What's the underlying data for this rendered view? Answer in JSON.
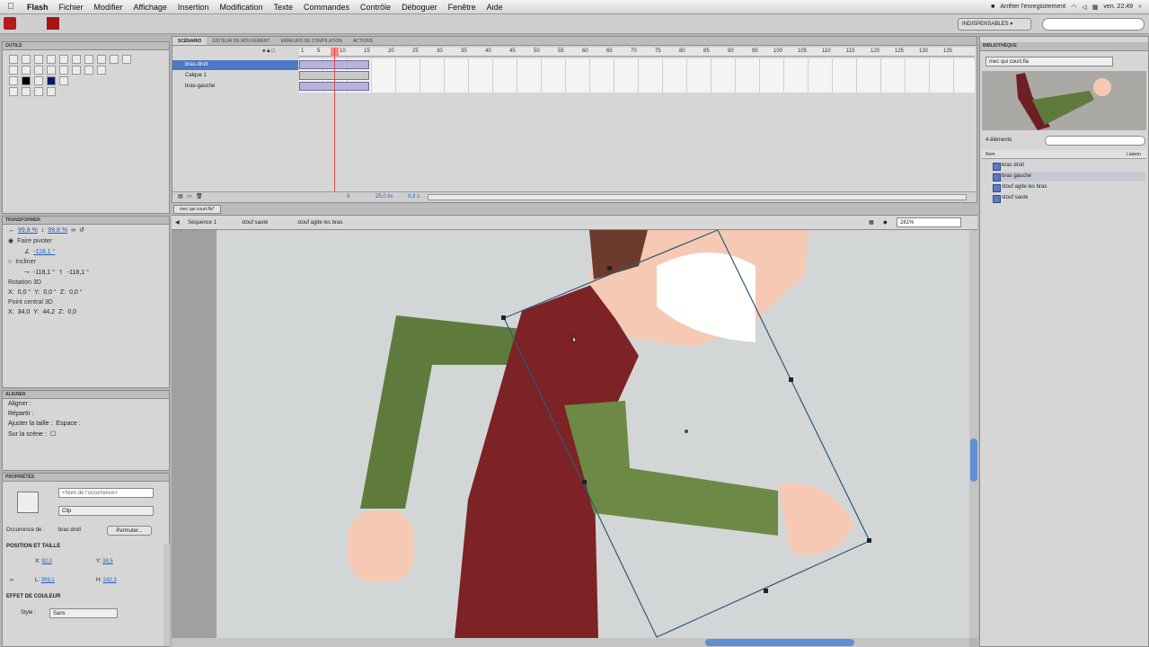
{
  "menubar": {
    "apple": "",
    "items": [
      "Flash",
      "Fichier",
      "Modifier",
      "Affichage",
      "Insertion",
      "Modification",
      "Texte",
      "Commandes",
      "Contrôle",
      "Déboguer",
      "Fenêtre",
      "Aide"
    ],
    "status_right": "Arrêter l'enregistrement",
    "clock": "ven. 22:49"
  },
  "appbar": {
    "workspace": "INDISPENSABLES ▾",
    "search_placeholder": ""
  },
  "tools_panel": {
    "title": "OUTILS"
  },
  "timeline": {
    "tabs": [
      "SCÉNARIO",
      "ÉDITEUR DE MOUVEMENT",
      "ERREURS DE COMPILATION",
      "ACTIONS"
    ],
    "layers": [
      "bras-droit",
      "Calque 1",
      "bras-gauche"
    ],
    "frame_numbers": [
      "1",
      "5",
      "10",
      "15",
      "20",
      "25",
      "30",
      "35",
      "40",
      "45",
      "50",
      "55",
      "60",
      "65",
      "70",
      "75",
      "80",
      "85",
      "90",
      "95",
      "100",
      "105",
      "110",
      "115",
      "120",
      "125",
      "130",
      "135"
    ],
    "status_frame": "9",
    "status_fps": "25,0 i/s",
    "status_time": "0,3 s"
  },
  "document": {
    "tab": "mec qui court.fla*",
    "breadcrumbs": [
      "Séquence 1",
      "stouf saute",
      "stouf agite les bras"
    ],
    "zoom": "281%"
  },
  "transform_panel": {
    "title": "TRANSFORMER",
    "width_pct": "99,8 %",
    "height_pct": "99,8 %",
    "rotate_label": "Faire pivoter",
    "rotate_value": "-118,1 °",
    "skew_label": "Incliner",
    "skew_h": "-118,1 °",
    "skew_v": "-118,1 °",
    "rot3d_label": "Rotation 3D",
    "rot3d": [
      "0,0 °",
      "0,0 °",
      "0,0 °"
    ],
    "center3d_label": "Point central 3D",
    "center3d": [
      "34,0",
      "44,2",
      "0,0"
    ]
  },
  "align_panel": {
    "title": "ALIGNER",
    "align_label": "Aligner :",
    "distribute_label": "Répartir :",
    "match_label": "Ajuster la taille :",
    "space_label": "Espace :",
    "to_stage": "Sur la scène :"
  },
  "properties_panel": {
    "title": "PROPRIÉTÉS",
    "instance_placeholder": "<Nom de l'occurrence>",
    "symbol_type": "Clip",
    "instance_of_label": "Occurrence de :",
    "instance_of_value": "bras droit",
    "swap_button": "Permuter...",
    "section_position": "POSITION ET TAILLE",
    "x": "92,0",
    "y": "38,5",
    "w": "309,1",
    "h": "242,3",
    "section_color": "EFFET DE COULEUR",
    "style_label": "Style :",
    "style_value": "Sans"
  },
  "library": {
    "title": "BIBLIOTHÈQUE",
    "doc_select": "mec qui court.fla",
    "count": "4 éléments",
    "column_name": "Nom",
    "column_link": "Liaison",
    "items": [
      "bras droit",
      "bras gauche",
      "stouf agite les bras",
      "stouf saute"
    ]
  },
  "colors": {
    "shirt": "#7d2225",
    "sleeve": "#5f7b3c",
    "skin": "#f5c9b4",
    "hair": "#6d3b2e",
    "selection": "#4d78c4",
    "bbox": "#2c5a7a"
  }
}
